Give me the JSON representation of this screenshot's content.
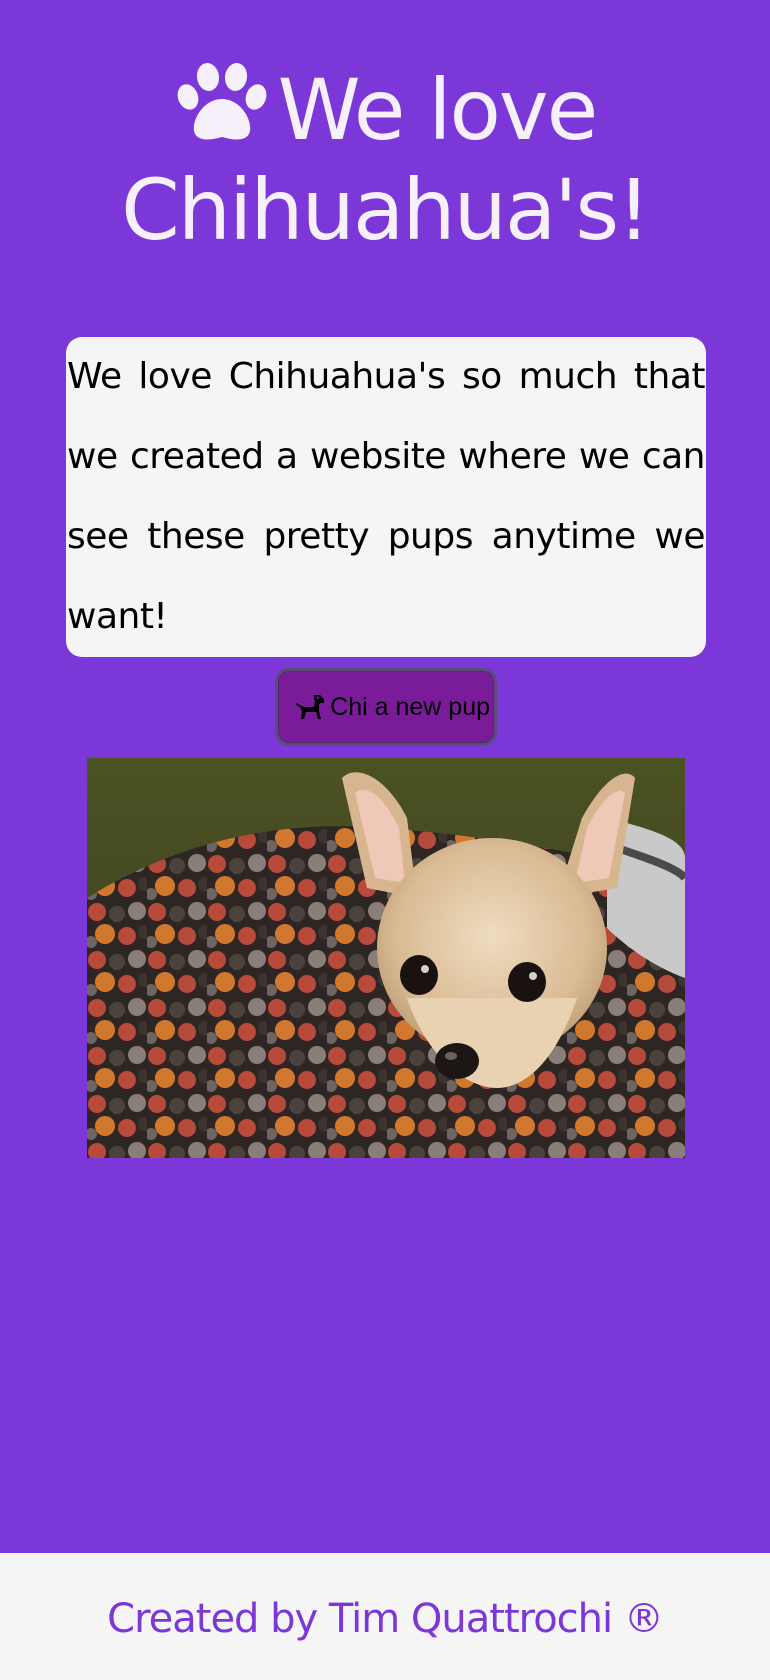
{
  "header": {
    "icon": "paw-icon",
    "title_line1": "We love",
    "title_line2": "Chihuahua's!"
  },
  "intro": {
    "text": "We love Chihuahua's so much that we created a website where we can see these pretty pups anytime we want!"
  },
  "button": {
    "icon": "dog-icon",
    "label": "Chi a new pup"
  },
  "footer": {
    "text": "Created by Tim Quattrochi ®"
  },
  "colors": {
    "background": "#7b37d8",
    "card": "#f5f5f5",
    "button": "#7a1b9a",
    "footer_text": "#7b37d8"
  }
}
